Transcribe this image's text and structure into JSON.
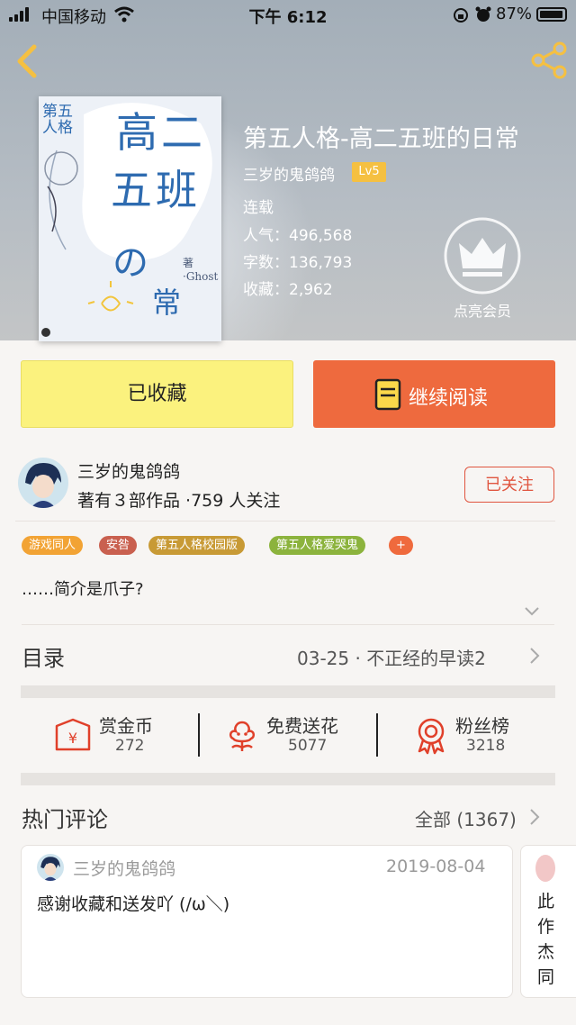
{
  "status_bar": {
    "carrier": "中国移动",
    "time": "下午 6:12",
    "battery": "87%"
  },
  "book": {
    "title": "第五人格-高二五班的日常",
    "author": "三岁的鬼鸽鸽",
    "level": "Lv5",
    "status": "连载",
    "popularity_label": "人气：",
    "popularity": "496,568",
    "words_label": "字数：",
    "words": "136,793",
    "collections_label": "收藏：",
    "collections": "2,962",
    "vip_label": "点亮会员",
    "cover_text": {
      "side": "第五人格",
      "title1": "高二",
      "title2": "五班",
      "title3": "の",
      "title4": "常",
      "author_mark": "著·Ghost"
    }
  },
  "actions": {
    "collect": "已收藏",
    "read": "继续阅读"
  },
  "author_info": {
    "name": "三岁的鬼鸽鸽",
    "stats": "著有３部作品 ·759 人关注",
    "follow": "已关注"
  },
  "tags": [
    "游戏同人",
    "安咎",
    "第五人格校园版",
    "第五人格爱哭鬼",
    "+"
  ],
  "intro": "……简介是爪子?",
  "toc": {
    "label": "目录",
    "latest": "03-25 · 不正经的早读2"
  },
  "stats": [
    {
      "label": "赏金币",
      "value": "272",
      "icon": "coin-envelope-icon"
    },
    {
      "label": "免费送花",
      "value": "5077",
      "icon": "flower-icon"
    },
    {
      "label": "粉丝榜",
      "value": "3218",
      "icon": "medal-icon"
    }
  ],
  "comments": {
    "label": "热门评论",
    "all": "全部 (1367)",
    "items": [
      {
        "user": "三岁的鬼鸽鸽",
        "date": "2019-08-04",
        "text": "感谢收藏和送发吖 (/ω＼)"
      },
      {
        "text": "此作杰同"
      }
    ]
  },
  "colors": {
    "accent": "#ee6a3e",
    "collect_bg": "#fbf27e",
    "follow": "#e0553f",
    "level": "#f5c041"
  }
}
